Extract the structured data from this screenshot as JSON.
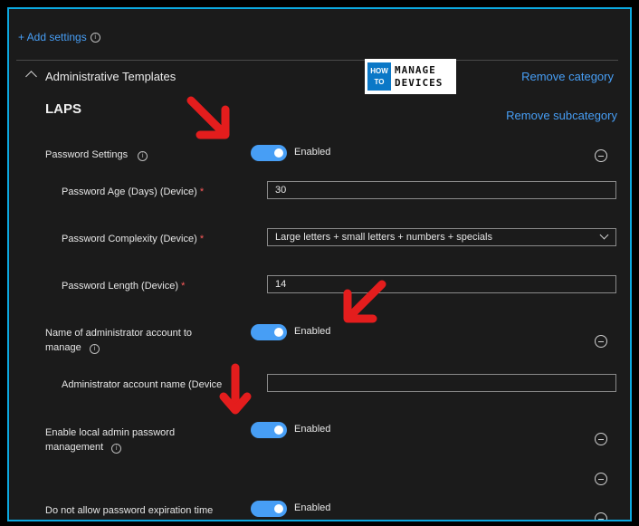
{
  "header": {
    "add_settings": "+ Add settings"
  },
  "category": {
    "title": "Administrative Templates",
    "remove_label": "Remove category"
  },
  "logo": {
    "line1": "HOW",
    "line2": "TO",
    "manage": "MANAGE",
    "devices": "DEVICES"
  },
  "subcategory": {
    "title": "LAPS",
    "remove_label": "Remove subcategory"
  },
  "settings": {
    "password_settings": {
      "label": "Password Settings",
      "state": "Enabled"
    },
    "password_age": {
      "label": "Password Age (Days) (Device)",
      "value": "30"
    },
    "password_complexity": {
      "label": "Password Complexity (Device)",
      "value": "Large letters + small letters + numbers + specials"
    },
    "password_length": {
      "label": "Password Length (Device)",
      "value": "14"
    },
    "admin_account": {
      "label_line1": "Name of administrator account to",
      "label_line2": "manage",
      "state": "Enabled"
    },
    "admin_account_name": {
      "label": "Administrator account name (Device",
      "value": ""
    },
    "local_admin_mgmt": {
      "label_line1": "Enable local admin password",
      "label_line2": "management",
      "state": "Enabled"
    },
    "no_expiration": {
      "label": "Do not allow password expiration time",
      "state": "Enabled"
    }
  },
  "colors": {
    "accent": "#479ef5",
    "annotation_arrow": "#e41d1d",
    "frame_border": "#0ba8e0"
  }
}
